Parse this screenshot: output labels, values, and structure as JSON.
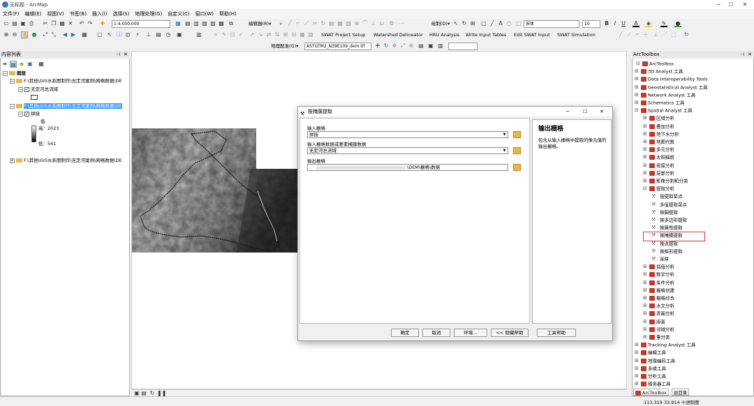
{
  "window": {
    "title": "无标题 - ArcMap"
  },
  "menu": [
    "文件(F)",
    "编辑(E)",
    "视图(V)",
    "书签(B)",
    "插入(I)",
    "选择(S)",
    "地理处理(G)",
    "自定义(C)",
    "窗口(W)",
    "帮助(H)"
  ],
  "toolbar": {
    "scale": "1:4,000,000",
    "editor": "编辑器(R)▾",
    "draw": "绘制(D)▾",
    "font": "宋体",
    "font_size": "10",
    "swat_items": [
      "SWAT Project Setup",
      "Watershed Delineator",
      "HRU Analysis",
      "Write Input Tables",
      "Edit SWAT Input",
      "SWAT Simulation"
    ],
    "georef": "地理配准(G)▾",
    "georef_layer": "ASTGTM2_N39E109_dem.tif"
  },
  "toc": {
    "title": "内容列表",
    "root": "图层",
    "items": [
      "F:\\其他\\GIS水系图制作\\无定河案例\\网络数据\\DE",
      "无定河总流域",
      "F:\\其他\\GIS水系图制作\\无定河案例\\网络数据\\DE",
      "拼接",
      "值",
      "高：2023",
      "低：541",
      "F:\\其他\\GIS水系图制作\\无定河案例\\网络数据\\DE"
    ]
  },
  "dialog": {
    "title": "按掩膜提取",
    "label_input": "输入栅格",
    "input_value": "拼接",
    "label_mask": "输入栅格数据或要素掩膜数据",
    "mask_value": "无定河总流域",
    "label_output": "输出栅格",
    "output_value": "\\DEM\\栅格\\数据",
    "help_title": "输出栅格",
    "help_text": "包含从输入栅格中提取的像元值的输出栅格。",
    "buttons": [
      "确定",
      "取消",
      "环境...",
      "<< 隐藏帮助",
      "工具帮助"
    ]
  },
  "arctoolbox": {
    "title": "ArcToolbox",
    "items": [
      {
        "text": "ArcToolbox",
        "lvl": 0
      },
      {
        "text": "3D Analyst 工具",
        "lvl": 1
      },
      {
        "text": "Data Interoperability Tools",
        "lvl": 1
      },
      {
        "text": "Geostatistical Analyst 工具",
        "lvl": 1
      },
      {
        "text": "Network Analyst 工具",
        "lvl": 1
      },
      {
        "text": "Schematics 工具",
        "lvl": 1
      },
      {
        "text": "Spatial Analyst 工具",
        "lvl": 1
      },
      {
        "text": "区域分析",
        "lvl": 2
      },
      {
        "text": "叠加分析",
        "lvl": 2
      },
      {
        "text": "地下水分析",
        "lvl": 2
      },
      {
        "text": "地图代数",
        "lvl": 2
      },
      {
        "text": "多元分析",
        "lvl": 2
      },
      {
        "text": "太阳辐射",
        "lvl": 2
      },
      {
        "text": "密度分析",
        "lvl": 2
      },
      {
        "text": "局部分析",
        "lvl": 2
      },
      {
        "text": "影像分割和分类",
        "lvl": 2
      },
      {
        "text": "提取分析",
        "lvl": 2
      },
      {
        "text": "值提取至点",
        "lvl": 3
      },
      {
        "text": "多值提取至点",
        "lvl": 3
      },
      {
        "text": "按圆提取",
        "lvl": 3
      },
      {
        "text": "按多边形提取",
        "lvl": 3
      },
      {
        "text": "按属性提取",
        "lvl": 3
      },
      {
        "text": "按掩膜提取",
        "lvl": 3
      },
      {
        "text": "按点提取",
        "lvl": 3
      },
      {
        "text": "按矩形提取",
        "lvl": 3
      },
      {
        "text": "采样",
        "lvl": 3
      },
      {
        "text": "插值分析",
        "lvl": 2
      },
      {
        "text": "数学分析",
        "lvl": 2
      },
      {
        "text": "条件分析",
        "lvl": 2
      },
      {
        "text": "栅格创建",
        "lvl": 2
      },
      {
        "text": "栅格综合",
        "lvl": 2
      },
      {
        "text": "水文分析",
        "lvl": 2
      },
      {
        "text": "表面分析",
        "lvl": 2
      },
      {
        "text": "距离",
        "lvl": 2
      },
      {
        "text": "邻域分析",
        "lvl": 2
      },
      {
        "text": "重分类",
        "lvl": 2
      },
      {
        "text": "Tracking Analyst 工具",
        "lvl": 1
      },
      {
        "text": "编辑工具",
        "lvl": 1
      },
      {
        "text": "地理编码工具",
        "lvl": 1
      },
      {
        "text": "多维工具",
        "lvl": 1
      },
      {
        "text": "分析工具",
        "lvl": 1
      },
      {
        "text": "服务器工具",
        "lvl": 1
      }
    ],
    "tabs": [
      "ArcToolbox",
      "目录"
    ]
  },
  "status": {
    "coords": "113.319  33.914 十进制度"
  },
  "colors": {
    "highlight_box": "#d9342b",
    "selection": "#3399ff"
  }
}
